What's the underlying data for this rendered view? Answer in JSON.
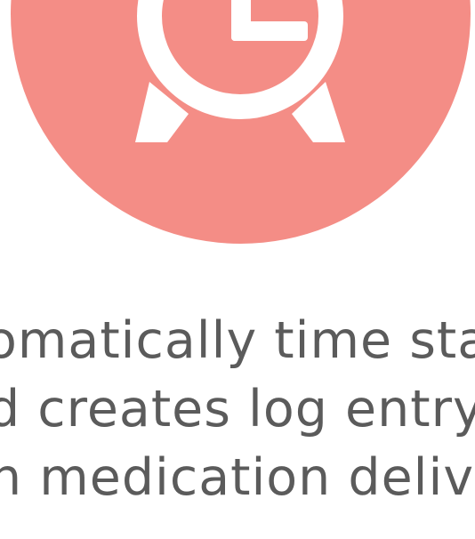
{
  "icon": {
    "name": "alarm-clock-icon",
    "badge_color": "#f48d86",
    "glyph_color": "#ffffff"
  },
  "caption": {
    "lines": [
      "omatically time star",
      "d creates log entry",
      "h medication deliv"
    ],
    "text_color": "#5b5b5b"
  }
}
